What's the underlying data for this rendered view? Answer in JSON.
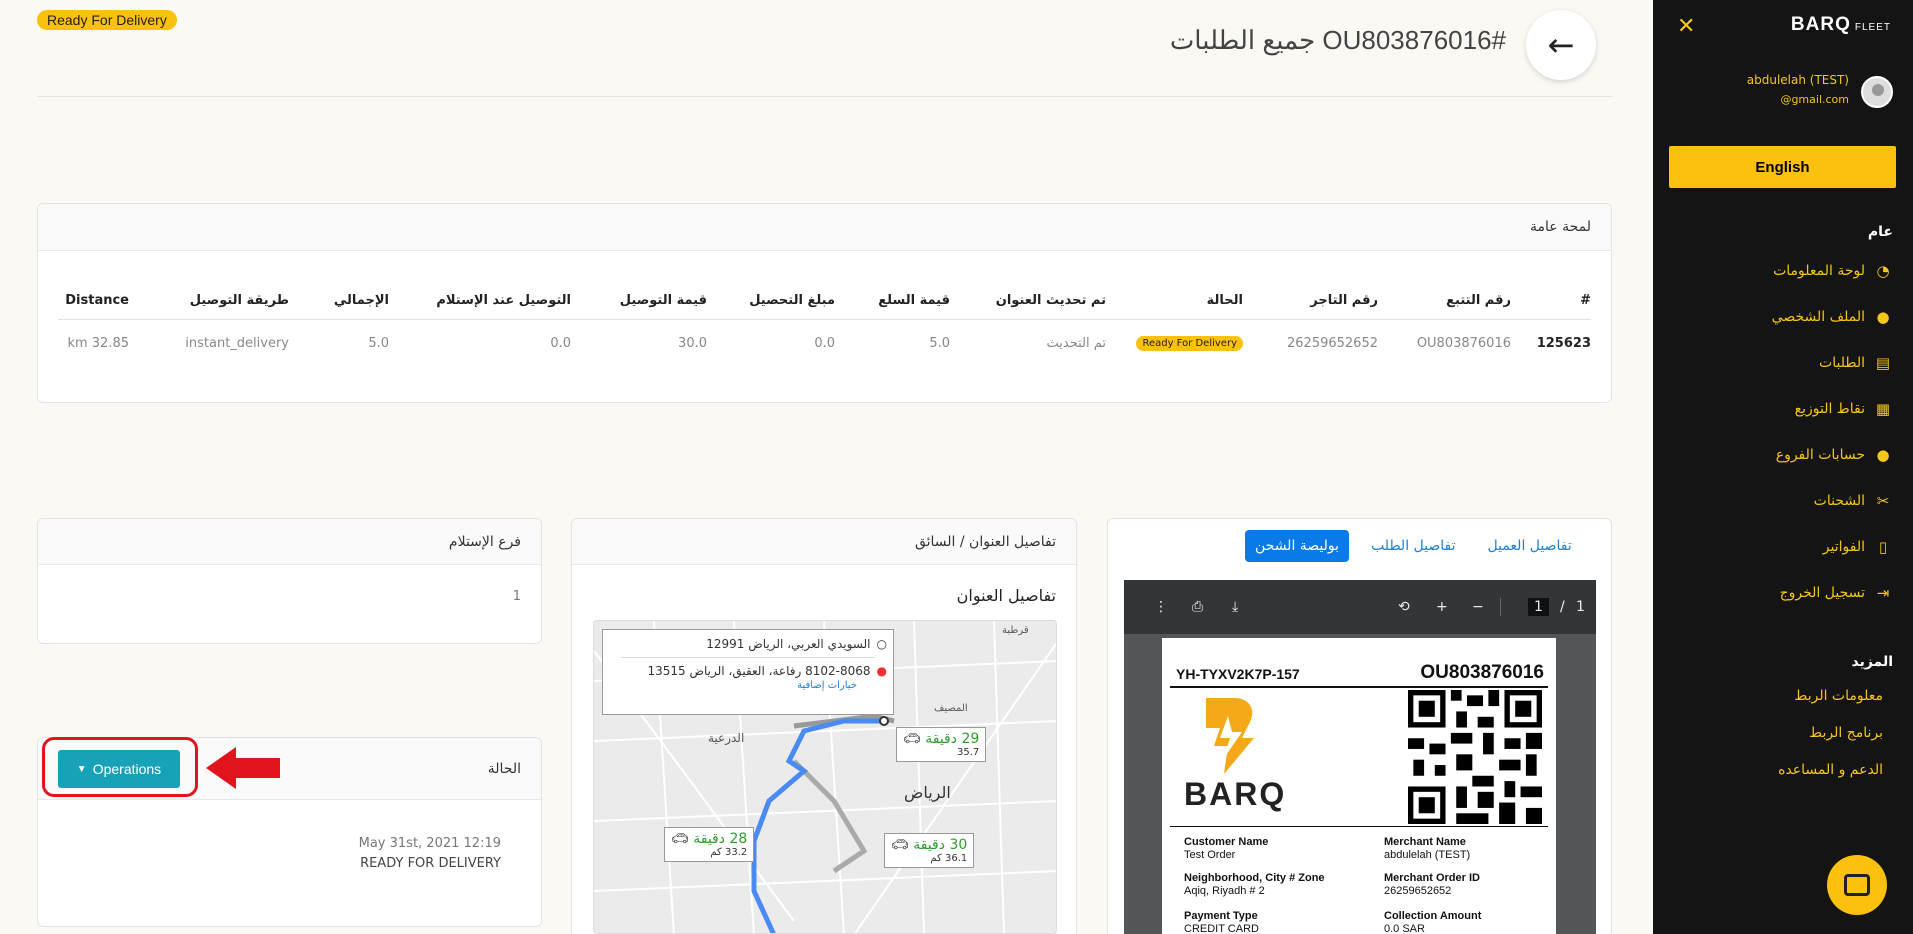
{
  "header": {
    "status_badge": "Ready For Delivery",
    "title": "OU803876016# جميع الطلبات",
    "back_icon": "arrow-left-icon"
  },
  "sidebar": {
    "logo": "BARQ",
    "logo_sub": "FLEET",
    "user_name": "abdulelah (TEST)",
    "user_email": "@gmail.com",
    "language_button": "English",
    "section_general": "عام",
    "items": [
      {
        "label": "لوحة المعلومات",
        "icon": "dashboard-icon"
      },
      {
        "label": "الملف الشخصي",
        "icon": "user-icon"
      },
      {
        "label": "الطلبات",
        "icon": "orders-icon"
      },
      {
        "label": "نقاط التوزيع",
        "icon": "warehouse-icon"
      },
      {
        "label": "حسابات الفروع",
        "icon": "user-icon"
      },
      {
        "label": "الشحنات",
        "icon": "shipments-icon"
      },
      {
        "label": "الفواتير",
        "icon": "invoice-icon"
      },
      {
        "label": "تسجيل الخروج",
        "icon": "logout-icon"
      }
    ],
    "section_more": "المزيد",
    "more_links": [
      "معلومات الربط",
      "برنامج الربط",
      "الدعم و المساعده"
    ]
  },
  "overview": {
    "title": "لمحة عامة",
    "columns": [
      "#",
      "رقم التتبع",
      "رقم التاجر",
      "الحالة",
      "تم تحديث العنوان",
      "قيمة السلع",
      "مبلغ التحصيل",
      "قيمة التوصيل",
      "التوصيل عند الإستلام",
      "الإجمالي",
      "طريقة التوصيل",
      "Distance"
    ],
    "row": [
      "125623",
      "OU803876016",
      "26259652652",
      "Ready For Delivery",
      "تم التحديث",
      "5.0",
      "0.0",
      "30.0",
      "0.0",
      "5.0",
      "instant_delivery",
      "km 32.85"
    ]
  },
  "pickup_branch": {
    "title": "فرع الإستلام",
    "value": "1"
  },
  "status_panel": {
    "title": "الحالة",
    "operations_button": "Operations",
    "date": "May 31st, 2021 12:19",
    "status_text": "READY FOR DELIVERY"
  },
  "address_panel": {
    "title": "تفاصيل العنوان / السائق",
    "subtitle": "تفاصيل العنوان",
    "map": {
      "from": "السويدي العربي، الرياض 12991",
      "to": "8102-8068 رفاعة، العقيق، الرياض 13515",
      "more_options": "خيارات إضافية",
      "routes": [
        {
          "time": "29 دقيقة",
          "distance": "35.7"
        },
        {
          "time": "28 دقيقة",
          "distance": "33.2 كم"
        },
        {
          "time": "30 دقيقة",
          "distance": "36.1 كم"
        }
      ],
      "places": [
        "الدرعية",
        "الرياض",
        "المصيف",
        "قرطبة"
      ]
    }
  },
  "waybill": {
    "tabs": [
      "تفاصيل العميل",
      "تفاصيل الطلب",
      "بوليصة الشحن"
    ],
    "active_tab": "بوليصة الشحن",
    "pdf": {
      "page_current": "1",
      "page_total": "1",
      "code_left": "YH-TYXV2K7P-157",
      "code_right": "OU803876016",
      "brand": "BARQ",
      "fields": [
        {
          "label": "Customer Name",
          "value": "Test Order"
        },
        {
          "label": "Merchant Name",
          "value": "abdulelah (TEST)"
        },
        {
          "label": "Neighborhood, City # Zone",
          "value": "Aqiq, Riyadh # 2"
        },
        {
          "label": "Merchant Order ID",
          "value": "26259652652"
        },
        {
          "label": "Payment Type",
          "value": "CREDIT CARD"
        },
        {
          "label": "Collection Amount",
          "value": "0.0 SAR"
        }
      ]
    }
  },
  "colors": {
    "brand_yellow": "#fcc10f",
    "sidebar_bg": "#141414",
    "operations_button": "#17a2b8",
    "tab_active": "#0a7ae8"
  }
}
